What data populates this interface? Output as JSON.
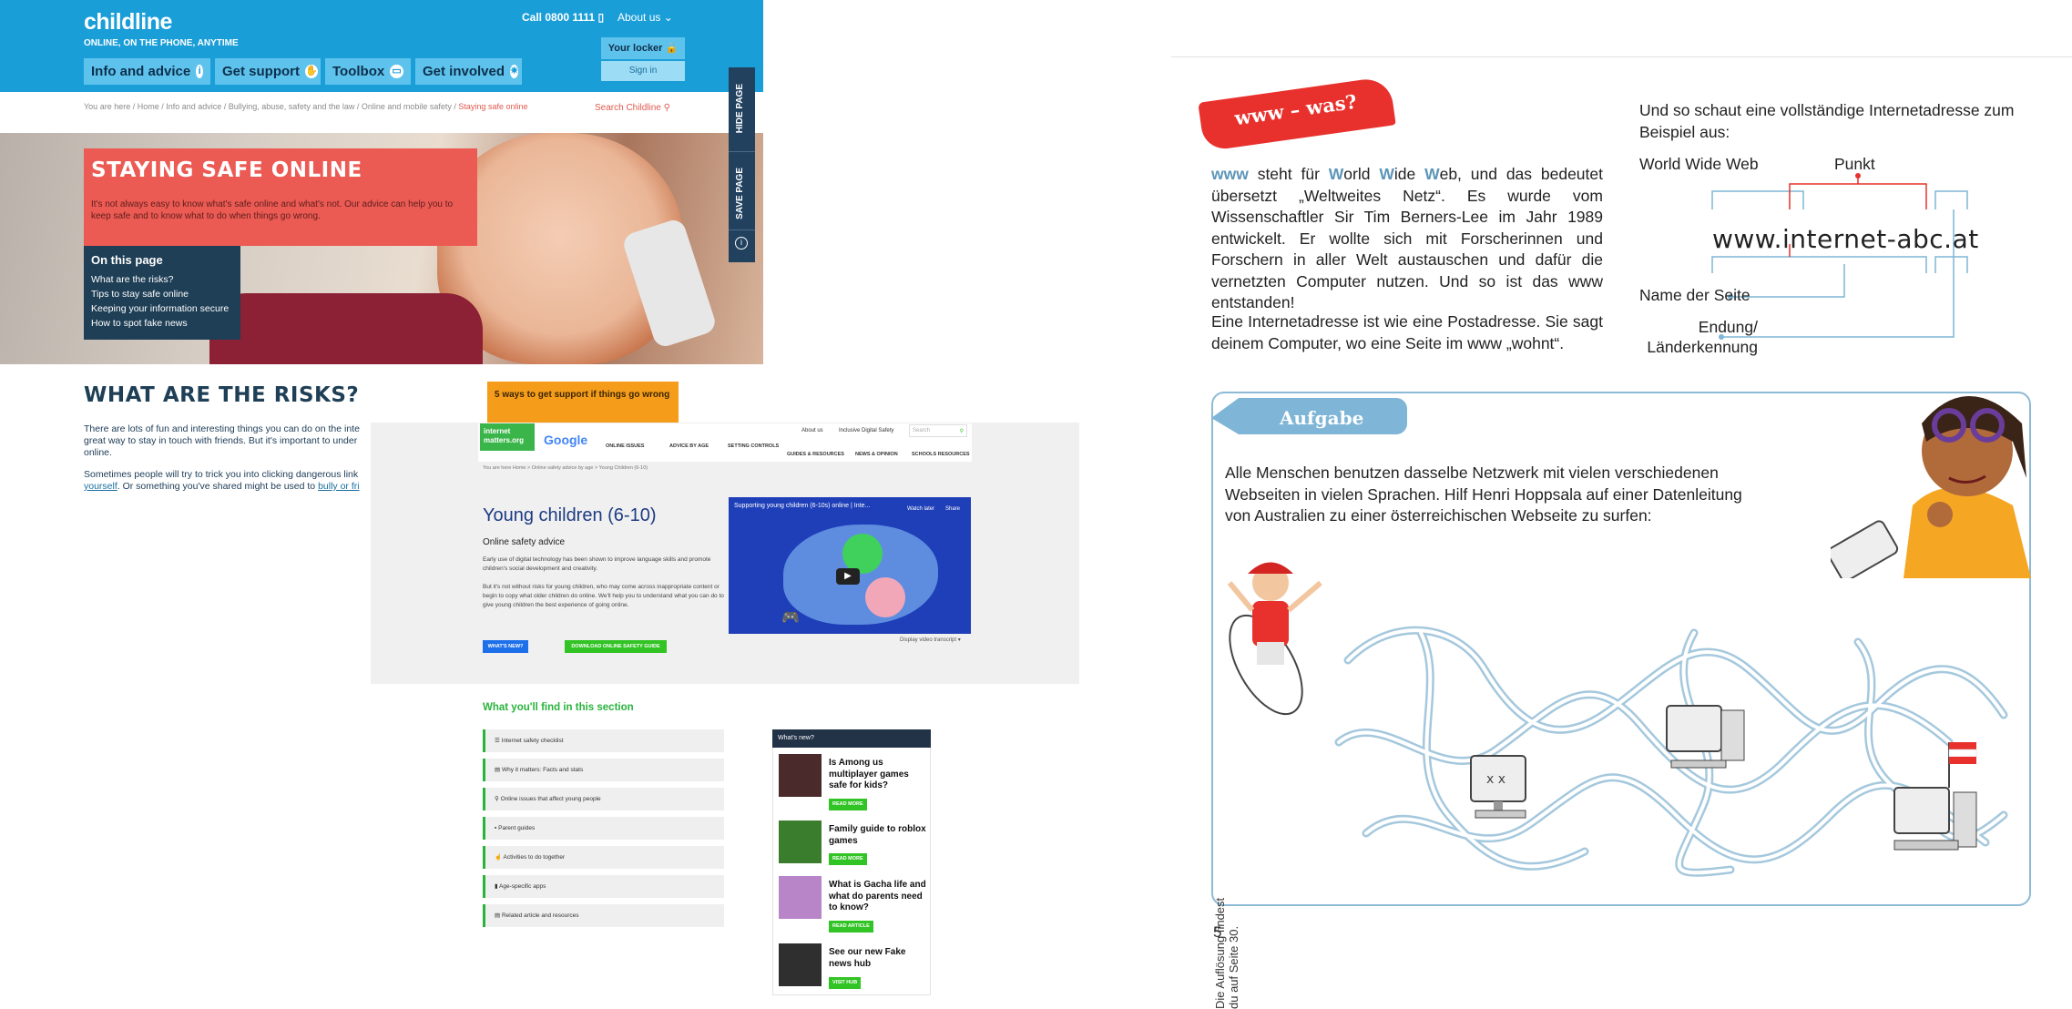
{
  "childline": {
    "logo": "childline",
    "tagline": "ONLINE, ON THE PHONE, ANYTIME",
    "call": "Call 0800 1111",
    "about": "About us",
    "nav": [
      "Info and advice",
      "Get support",
      "Toolbox",
      "Get involved"
    ],
    "locker": "Your locker",
    "sign_in": "Sign in",
    "breadcrumb": "You are here / Home / Info and advice / Bullying, abuse, safety and the law / Online and mobile safety / ",
    "breadcrumb_current": "Staying safe online",
    "search": "Search Childline",
    "side_hide": "HIDE PAGE",
    "side_save": "SAVE PAGE",
    "hero_title": "STAYING SAFE ONLINE",
    "hero_text": "It's not always easy to know what's safe online and what's not. Our advice can help you to keep safe and to know what to do when things go wrong.",
    "on_this_page_title": "On this page",
    "on_this_page": [
      "What are the risks?",
      "Tips to stay safe online",
      "Keeping your information secure",
      "How to spot fake news"
    ],
    "risks_title": "WHAT ARE THE RISKS?",
    "risks_p1": "There are lots of fun and interesting things you can do on the inte great way to stay in touch with friends. But it's important to under online.",
    "risks_p2_a": "Sometimes people will try to trick you into clicking dangerous link ",
    "risks_p2_link1": "yourself",
    "risks_p2_b": ". Or something you've shared might be used to ",
    "risks_p2_link2": "bully or fri",
    "orange_box": "5 ways to get support if things go wrong"
  },
  "internetmatters": {
    "logo": "internet matters.org",
    "partner": "Google",
    "top_links": [
      "About us",
      "Inclusive Digital Safety"
    ],
    "search_placeholder": "Search",
    "nav_row1": [
      "ONLINE ISSUES",
      "ADVICE BY AGE",
      "SETTING CONTROLS"
    ],
    "nav_row2": [
      "GUIDES & RESOURCES",
      "NEWS & OPINION",
      "SCHOOLS RESOURCES"
    ],
    "breadcrumb": "You are here  Home  >  Online safety advice by age  >  Young Children (6-10)",
    "title": "Young children (6-10)",
    "subtitle": "Online safety advice",
    "p1": "Early use of digital technology has been shown to improve language skills and promote children's social development and creativity.",
    "p2": "But it's not without risks for young children, who may come across inappropriate content or begin to copy what older children do online. We'll help you to understand what you can do to give young children the best experience of going online.",
    "btn_whats_new": "WHAT'S NEW?",
    "btn_download": "DOWNLOAD ONLINE SAFETY GUIDE",
    "video_title": "Supporting young children (6-10s) online | Inte...",
    "video_watch_later": "Watch later",
    "video_share": "Share",
    "transcript": "Display video transcript",
    "section_title": "What you'll find in this section",
    "section_items": [
      "Internet safety checklist",
      "Why it matters: Facts and stats",
      "Online issues that affect young people",
      "Parent guides",
      "Activities to do together",
      "Age-specific apps",
      "Related article and resources"
    ],
    "whats_new_header": "What's new?",
    "news": [
      {
        "title": "Is Among us multiplayer games safe for kids?",
        "button": "READ MORE"
      },
      {
        "title": "Family guide to roblox games",
        "button": "READ MORE"
      },
      {
        "title": "What is Gacha life and what do parents need to know?",
        "button": "READ ARTICLE"
      },
      {
        "title": "See our new Fake news hub",
        "button": "VISIT HUB"
      }
    ]
  },
  "abc": {
    "badge": "www – was?",
    "p1_www": "www",
    "p1_a": " steht für ",
    "p1_w1": "W",
    "p1_orld": "orld ",
    "p1_w2": "W",
    "p1_ide": "ide ",
    "p1_w3": "W",
    "p1_b": "eb, und das bedeutet übersetzt „Weltweites Netz“. Es wurde vom Wissenschaftler Sir Tim Berners-Lee im Jahr 1989 entwickelt. Er wollte sich mit Forscherinnen und Forschern in aller Welt austauschen und dafür die vernetzten Computer nutzen. Und so ist das www entstanden!",
    "p2": "Eine Internetadresse ist wie eine Postadresse. Sie sagt deinem Computer, wo eine Seite im www „wohnt“.",
    "intro": "Und so schaut eine vollständige Internetadresse zum Beispiel aus:",
    "label_www": "World Wide Web",
    "label_punkt": "Punkt",
    "url": "www.internet-abc.at",
    "label_name": "Name der Seite",
    "label_endung": "Endung/ Länderkennung",
    "task_label": "Aufgabe",
    "task_text": "Alle Menschen benutzen dasselbe Netzwerk mit vielen verschiedenen Webseiten in vielen Sprachen. Hilf Henri Hoppsala auf einer Datenleitung von Australien zu einer österreichischen Webseite zu surfen:",
    "solution": "Die Auflösung findest du auf Seite 30.",
    "page_number": "5",
    "colors": {
      "accent_red": "#e8312c",
      "accent_blue": "#8dbbd5"
    }
  }
}
